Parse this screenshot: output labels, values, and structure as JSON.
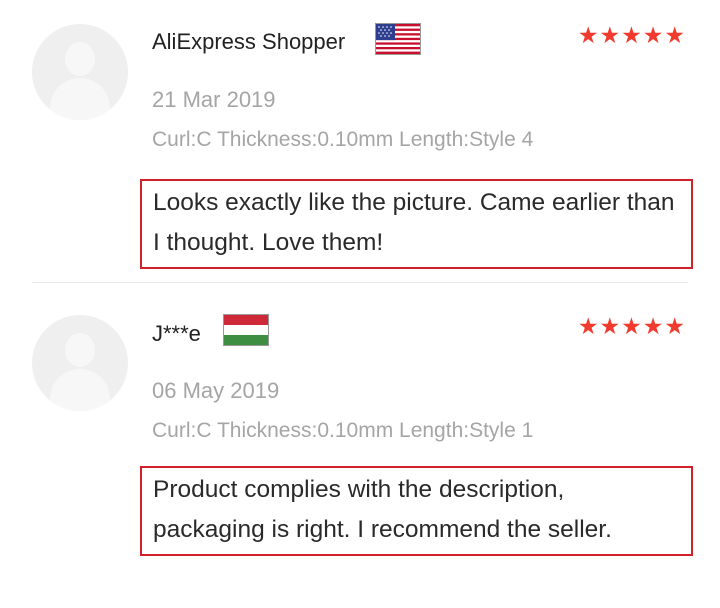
{
  "reviews": [
    {
      "name": "AliExpress Shopper",
      "country_flag": "us-flag-icon",
      "rating": 5,
      "stars": "★★★★★",
      "date": "21 Mar 2019",
      "sku": "Curl:C Thickness:0.10mm Length:Style 4",
      "comment": "Looks exactly like the picture. Came earlier than I thought. Love them!"
    },
    {
      "name": "J***e",
      "country_flag": "hu-flag-icon",
      "rating": 5,
      "stars": "★★★★★",
      "date": "06 May 2019",
      "sku": "Curl:C Thickness:0.10mm Length:Style 1",
      "comment": "Product complies with the description, packaging is right. I recommend the seller."
    }
  ],
  "colors": {
    "star": "#f23b2f",
    "highlight_border": "#d0202a",
    "meta_text": "#a5a5a5"
  }
}
